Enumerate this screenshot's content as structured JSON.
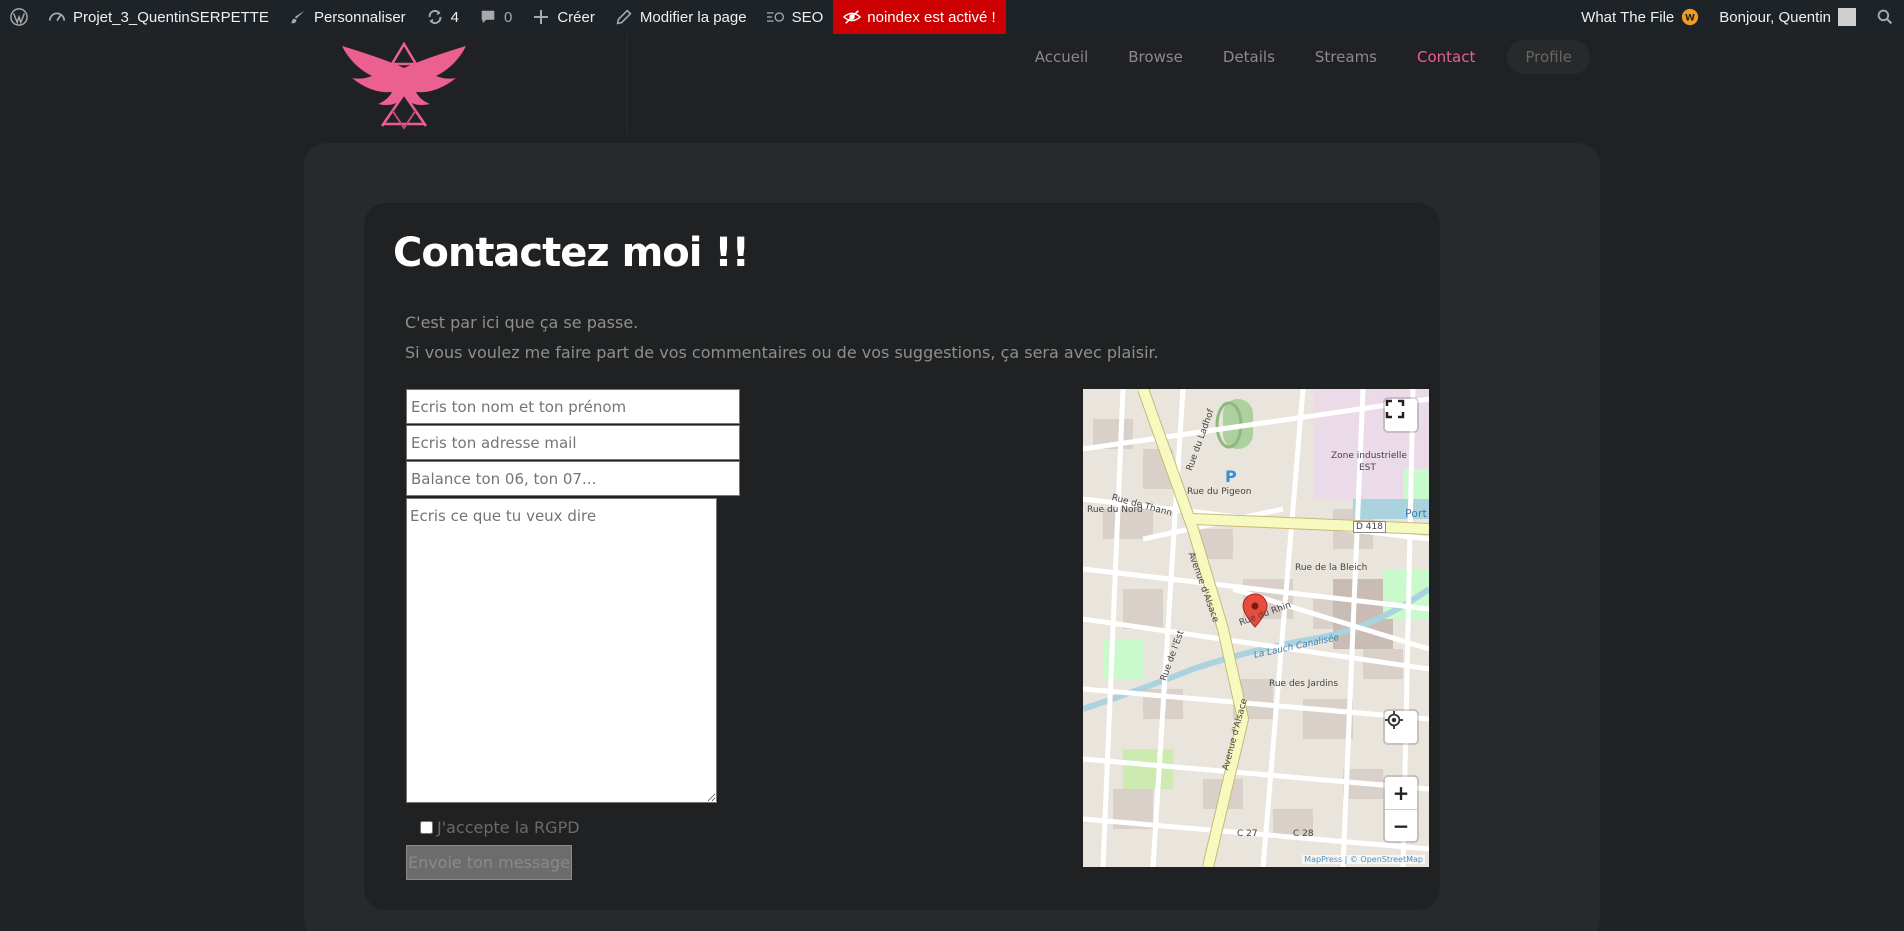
{
  "adminbar": {
    "site_name": "Projet_3_QuentinSERPETTE",
    "customize": "Personnaliser",
    "updates_count": "4",
    "comments_count": "0",
    "create": "Créer",
    "edit_page": "Modifier la page",
    "seo": "SEO",
    "noindex": "noindex est activé !",
    "what_the_file": "What The File",
    "greeting": "Bonjour, Quentin"
  },
  "nav": {
    "items": [
      "Accueil",
      "Browse",
      "Details",
      "Streams",
      "Contact"
    ],
    "active": "Contact",
    "profile": "Profile"
  },
  "contact": {
    "title": "Contactez moi !!",
    "intro_line1": "C'est par ici que ça se passe.",
    "intro_line2": "Si vous voulez me faire part de vos commentaires ou de vos suggestions, ça sera avec plaisir.",
    "name_placeholder": "Ecris ton nom et ton prénom",
    "email_placeholder": "Ecris ton adresse mail",
    "phone_placeholder": "Balance ton 06, ton 07...",
    "message_placeholder": "Ecris ce que tu veux dire",
    "rgpd_label": "J'accepte la RGPD",
    "submit_label": "Envoie ton message"
  },
  "map": {
    "labels": {
      "rue_du_ladhof": "Rue du Ladhof",
      "avenue_dalsace": "Avenue d'Alsace",
      "avenue_dalsace_2": "Avenue d'Alsace",
      "zone_industrielle": "Zone industrielle",
      "zone_industrielle_2": "EST",
      "d418": "D 418",
      "port": "Port du",
      "rue_du_rhin": "Rue du Rhin",
      "rue_des_jardins": "Rue des Jardins",
      "rue_de_la_bleich": "Rue de la Bleich",
      "rue_du_pigeon": "Rue du Pigeon",
      "rue_de_thann": "Rue de Thann",
      "rue_du_nord": "Rue du Nord",
      "rue_de_lest": "Rue de l'Est",
      "parking": "P",
      "lauch": "La Lauch Canalisée",
      "c28": "C 28",
      "c27": "C 27"
    },
    "attribution": "MapPress | © OpenStreetMap",
    "zoom_in": "+",
    "zoom_out": "−"
  },
  "colors": {
    "accent": "#ec6090",
    "adminbar": "#1d2327",
    "noindex": "#cc0000",
    "card": "#27292a"
  }
}
